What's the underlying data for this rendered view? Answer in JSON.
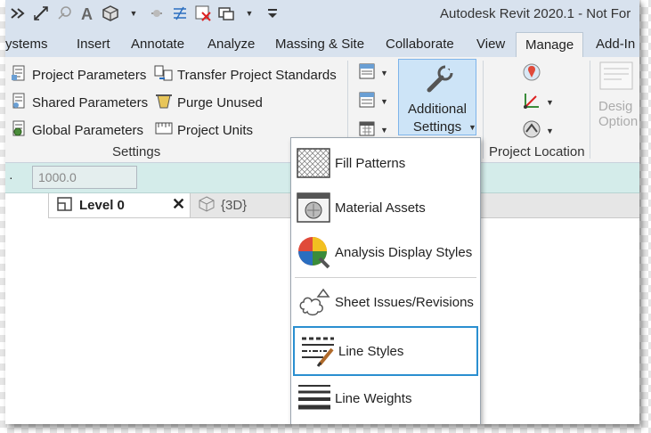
{
  "title_bar": {
    "app_title": "Autodesk Revit 2020.1 - Not For"
  },
  "ribbon_tabs": [
    "ystems",
    "Insert",
    "Annotate",
    "Analyze",
    "Massing & Site",
    "Collaborate",
    "View",
    "Manage",
    "Add-In"
  ],
  "active_tab": "Manage",
  "settings_panel": {
    "label": "Settings",
    "buttons": {
      "project_parameters": "Project  Parameters",
      "shared_parameters": "Shared  Parameters",
      "global_parameters": "Global  Parameters",
      "transfer_project_standards": "Transfer  Project Standards",
      "purge_unused": "Purge  Unused",
      "project_units": "Project  Units"
    },
    "additional_settings": {
      "line1": "Additional",
      "line2": "Settings"
    }
  },
  "project_location_panel": {
    "label": "Project Location"
  },
  "design_options_panel": {
    "line1": "Desig",
    "line2": "Option"
  },
  "options_bar": {
    "value": "1000.0"
  },
  "view_tabs": {
    "level": "Level 0",
    "threed": "{3D}"
  },
  "dropdown": {
    "items": {
      "fill_patterns": "Fill Patterns",
      "material_assets": "Material Assets",
      "analysis_display_styles": "Analysis Display Styles",
      "sheet_issues_revisions": "Sheet Issues/Revisions",
      "line_styles": "Line Styles",
      "line_weights": "Line Weights"
    },
    "highlighted": "Line Styles"
  },
  "colors": {
    "accent": "#2a8fd0",
    "ribbon_bg": "#f3f3f3",
    "options_bar": "#d4ecea"
  }
}
